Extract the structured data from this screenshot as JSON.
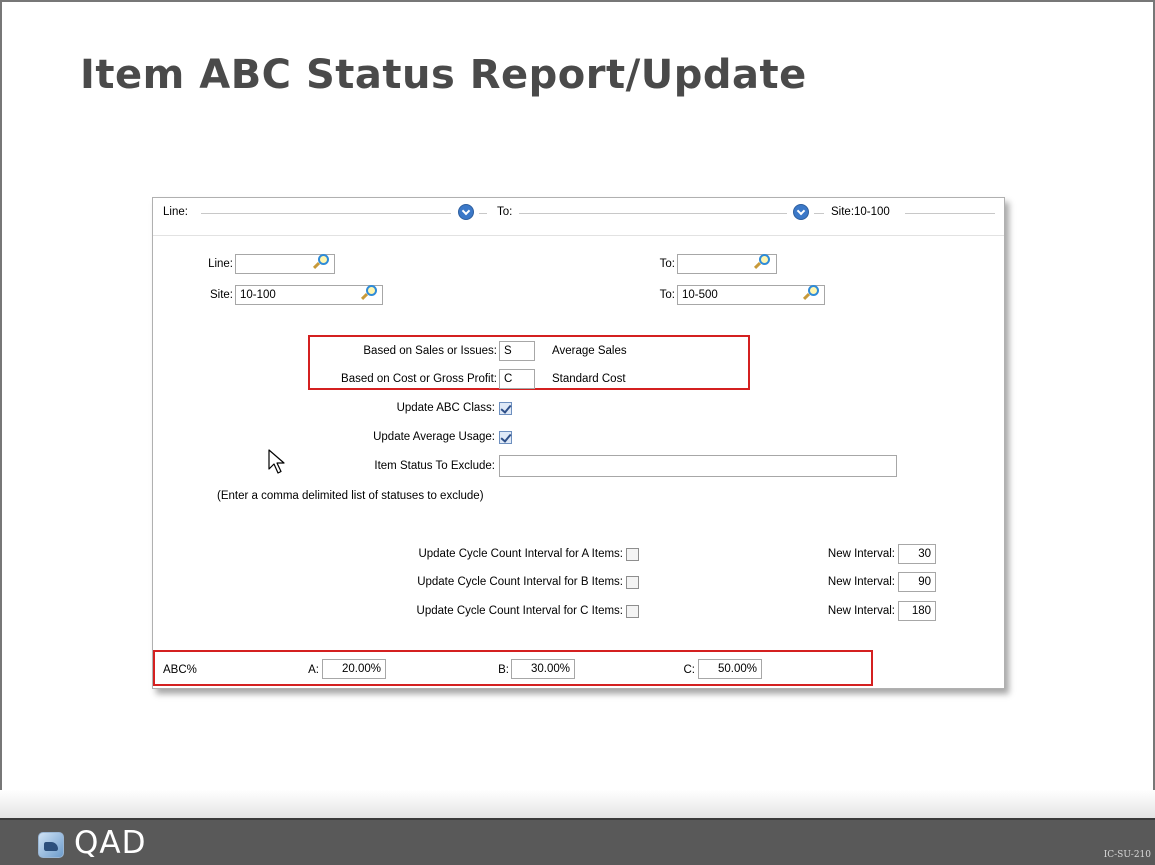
{
  "slide": {
    "title": "Item ABC Status Report/Update",
    "code": "IC-SU-210"
  },
  "topbar": {
    "line_label": "Line:",
    "to_label": "To:",
    "site_label": "Site:10-100"
  },
  "filters": {
    "line_label": "Line:",
    "line_value": "",
    "line_to_label": "To:",
    "line_to_value": "",
    "site_label": "Site:",
    "site_value": "10-100",
    "site_to_label": "To:",
    "site_to_value": "10-500"
  },
  "basis": {
    "sales_label": "Based on Sales or Issues:",
    "sales_value": "S",
    "sales_desc": "Average Sales",
    "cost_label": "Based on Cost or Gross Profit:",
    "cost_value": "C",
    "cost_desc": "Standard Cost"
  },
  "options": {
    "update_abc_label": "Update ABC Class:",
    "update_abc_checked": true,
    "update_usage_label": "Update Average Usage:",
    "update_usage_checked": true,
    "exclude_label": "Item Status To Exclude:",
    "exclude_value": "",
    "exclude_hint": "(Enter a comma delimited list of statuses to exclude)"
  },
  "cycle_count": {
    "rows": [
      {
        "label": "Update Cycle Count Interval for A Items:",
        "checked": false,
        "interval_label": "New Interval:",
        "interval_value": "30"
      },
      {
        "label": "Update Cycle Count Interval for B Items:",
        "checked": false,
        "interval_label": "New Interval:",
        "interval_value": "90"
      },
      {
        "label": "Update Cycle Count Interval for C Items:",
        "checked": false,
        "interval_label": "New Interval:",
        "interval_value": "180"
      }
    ]
  },
  "abc": {
    "label": "ABC%",
    "a_label": "A:",
    "a_value": "20.00%",
    "b_label": "B:",
    "b_value": "30.00%",
    "c_label": "C:",
    "c_value": "50.00%"
  },
  "footer": {
    "logo_text": "QAD"
  },
  "colors": {
    "highlight_box": "#d42020",
    "footer_bg": "#595959",
    "title": "#4a4a4a"
  },
  "icons": [
    "dropdown-icon",
    "lookup-icon",
    "checkbox",
    "mouse-pointer-icon",
    "qad-logo-icon"
  ]
}
